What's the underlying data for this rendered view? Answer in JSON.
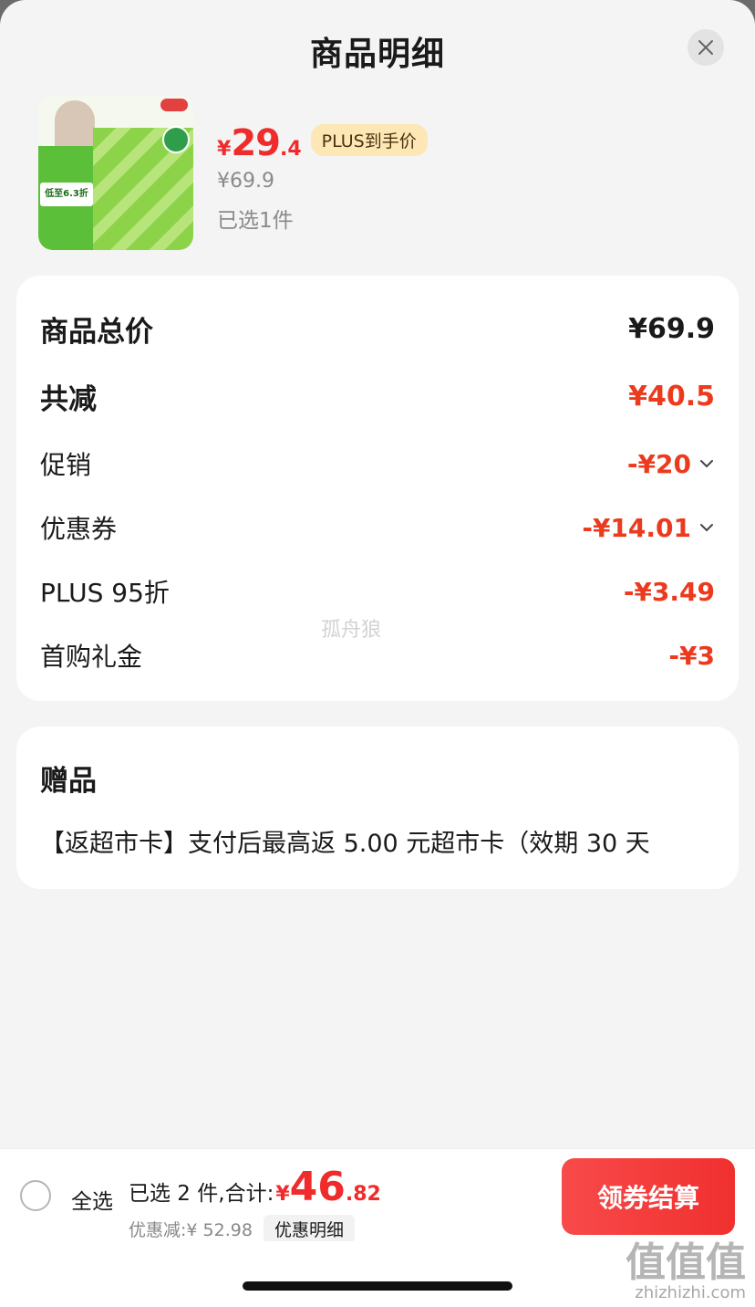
{
  "header": {
    "title": "商品明细",
    "close_icon": "close-icon"
  },
  "product": {
    "price_currency": "¥",
    "price_integer": "29",
    "price_decimal": ".4",
    "price_tag": "PLUS到手价",
    "original_price": "¥69.9",
    "selected_count": "已选1件",
    "thumb_promo": "低至6.3折"
  },
  "breakdown": {
    "total_label": "商品总价",
    "total_value": "¥69.9",
    "reduce_label": "共减",
    "reduce_value": "¥40.5",
    "items": [
      {
        "label": "促销",
        "value": "-¥20",
        "expandable": true
      },
      {
        "label": "优惠券",
        "value": "-¥14.01",
        "expandable": true
      },
      {
        "label": "PLUS 95折",
        "value": "-¥3.49",
        "expandable": false
      },
      {
        "label": "首购礼金",
        "value": "-¥3",
        "expandable": false
      }
    ]
  },
  "watermark": "孤舟狼",
  "gift": {
    "title": "赠品",
    "text": "【返超市卡】支付后最高返 5.00 元超市卡（效期 30 天"
  },
  "footer": {
    "select_all": "全选",
    "summary_label": "已选 2 件,合计:",
    "total_currency": "¥",
    "total_integer": "46",
    "total_decimal": ".82",
    "discount_text": "优惠减:¥ 52.98",
    "detail_button": "优惠明细",
    "checkout_button": "领券结算"
  },
  "corner_mark": {
    "logo": "值值值",
    "url": "zhizhizhi.com"
  },
  "colors": {
    "accent": "#f02b2b",
    "tag_bg": "#fde7b5",
    "checkout": "#f0302f"
  }
}
